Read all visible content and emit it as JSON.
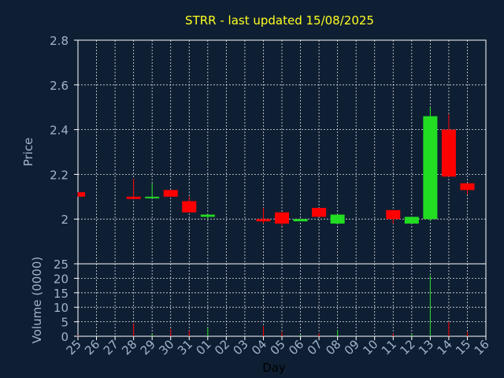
{
  "chart_data": {
    "type": "candlestick",
    "title": "STRR - last updated 15/08/2025",
    "xlabel": "Day",
    "price_panel": {
      "ylabel": "Price",
      "ylim": [
        1.8,
        2.8
      ],
      "yticks": [
        "2",
        "2.2",
        "2.4",
        "2.6",
        "2.8"
      ],
      "grid": true
    },
    "volume_panel": {
      "ylabel": "Volume (0000)",
      "ylim": [
        0,
        25
      ],
      "yticks": [
        "0",
        "5",
        "10",
        "15",
        "20",
        "25"
      ],
      "grid": true
    },
    "x_ticks": [
      "25",
      "26",
      "27",
      "28",
      "29",
      "30",
      "31",
      "01",
      "02",
      "03",
      "04",
      "05",
      "06",
      "07",
      "08",
      "09",
      "10",
      "11",
      "12",
      "13",
      "14",
      "15",
      "16"
    ],
    "up_color": "#22dd22",
    "down_color": "#ff0000",
    "candles": [
      {
        "day": "25",
        "open": 2.12,
        "high": 2.12,
        "low": 2.1,
        "close": 2.1,
        "volume": 0.3
      },
      {
        "day": "28",
        "open": 2.1,
        "high": 2.18,
        "low": 2.09,
        "close": 2.09,
        "volume": 4.5
      },
      {
        "day": "29",
        "open": 2.1,
        "high": 2.16,
        "low": 2.1,
        "close": 2.1,
        "volume": 0.8
      },
      {
        "day": "30",
        "open": 2.13,
        "high": 2.13,
        "low": 2.1,
        "close": 2.1,
        "volume": 2.5
      },
      {
        "day": "31",
        "open": 2.08,
        "high": 2.1,
        "low": 2.03,
        "close": 2.03,
        "volume": 2.0
      },
      {
        "day": "01",
        "open": 2.01,
        "high": 2.02,
        "low": 2.0,
        "close": 2.02,
        "volume": 3.0
      },
      {
        "day": "04",
        "open": 2.0,
        "high": 2.05,
        "low": 1.98,
        "close": 1.99,
        "volume": 3.5
      },
      {
        "day": "05",
        "open": 2.03,
        "high": 2.03,
        "low": 1.97,
        "close": 1.98,
        "volume": 1.5
      },
      {
        "day": "06",
        "open": 1.99,
        "high": 2.0,
        "low": 1.99,
        "close": 2.0,
        "volume": 0.5
      },
      {
        "day": "07",
        "open": 2.05,
        "high": 2.05,
        "low": 2.01,
        "close": 2.01,
        "volume": 1.0
      },
      {
        "day": "08",
        "open": 1.98,
        "high": 2.02,
        "low": 1.98,
        "close": 2.02,
        "volume": 2.0
      },
      {
        "day": "11",
        "open": 2.04,
        "high": 2.04,
        "low": 1.98,
        "close": 2.0,
        "volume": 1.0
      },
      {
        "day": "12",
        "open": 1.98,
        "high": 2.01,
        "low": 1.98,
        "close": 2.01,
        "volume": 0.8
      },
      {
        "day": "13",
        "open": 2.0,
        "high": 2.5,
        "low": 1.99,
        "close": 2.46,
        "volume": 21.0
      },
      {
        "day": "14",
        "open": 2.4,
        "high": 2.47,
        "low": 2.19,
        "close": 2.19,
        "volume": 5.0
      },
      {
        "day": "15",
        "open": 2.16,
        "high": 2.16,
        "low": 2.11,
        "close": 2.13,
        "volume": 1.5
      }
    ]
  }
}
